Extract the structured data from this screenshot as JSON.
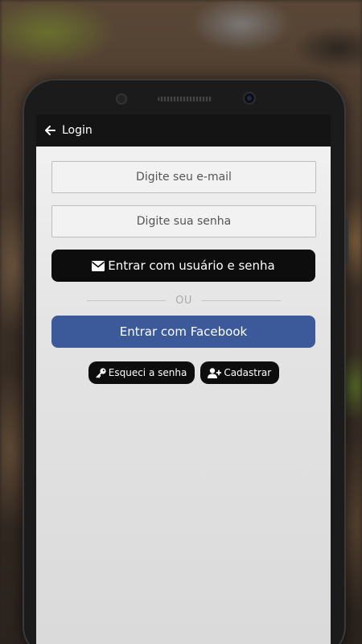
{
  "appbar": {
    "back_icon": "arrow-left-icon",
    "title": "Login"
  },
  "form": {
    "email_placeholder": "Digite seu e-mail",
    "password_placeholder": "Digite sua senha",
    "login_button": {
      "icon": "envelope-icon",
      "label": "Entrar com usuário e senha"
    },
    "divider_text": "OU",
    "facebook_button": {
      "label": "Entrar com Facebook",
      "color": "#3c5a99"
    },
    "forgot_button": {
      "icon": "key-icon",
      "label": "Esqueci a senha"
    },
    "register_button": {
      "icon": "user-plus-icon",
      "label": "Cadastrar"
    }
  }
}
